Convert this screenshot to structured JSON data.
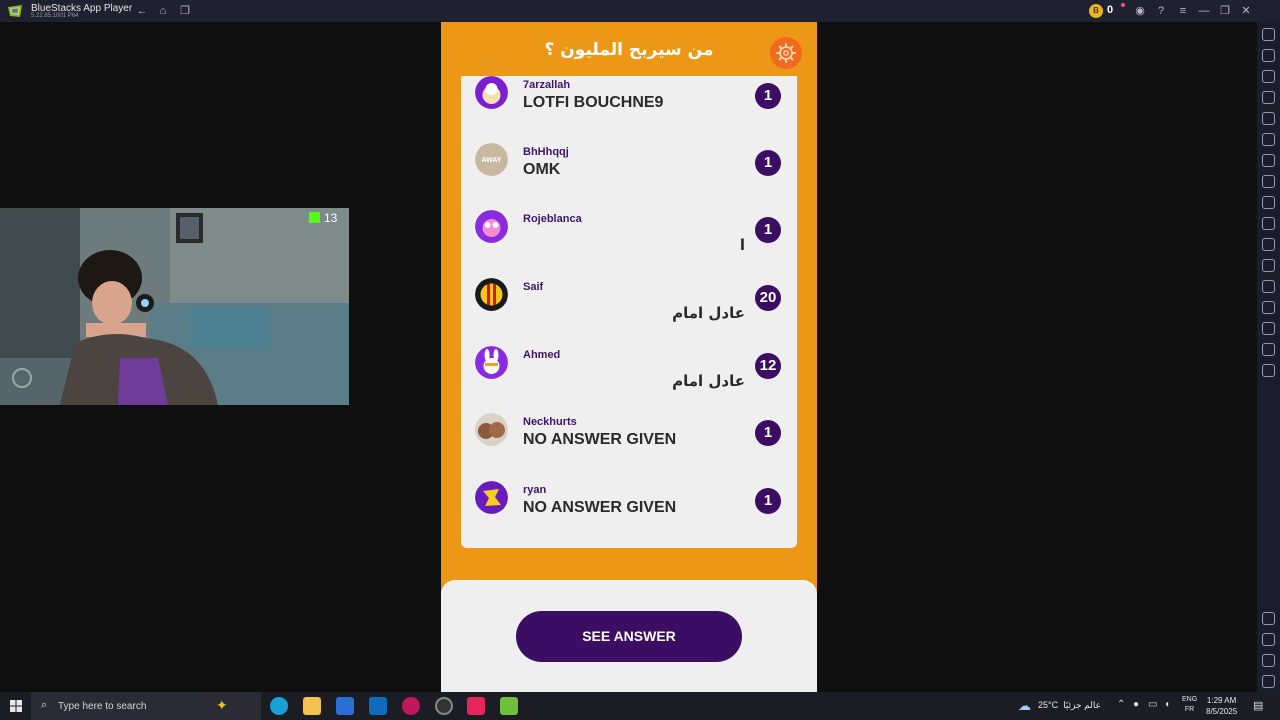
{
  "window": {
    "title": "BlueStacks App Player",
    "version": "5.22.85.1001 P64",
    "coins": "0"
  },
  "game": {
    "title": "من سيربح المليون ؟",
    "rows": [
      {
        "user": "7arzallah",
        "answer": "LOTFI BOUCHNE9",
        "count": "1",
        "rtl": false
      },
      {
        "user": "BhHhqqj",
        "answer": "OMK",
        "count": "1",
        "rtl": false
      },
      {
        "user": "Rojeblanca",
        "answer": "ا",
        "count": "1",
        "rtl": true
      },
      {
        "user": "Saif",
        "answer": "عادل امام",
        "count": "20",
        "rtl": true
      },
      {
        "user": "Ahmed",
        "answer": "عادل امام",
        "count": "12",
        "rtl": true
      },
      {
        "user": "Neckhurts",
        "answer": "NO ANSWER GIVEN",
        "count": "1",
        "rtl": false
      },
      {
        "user": "ryan",
        "answer": "NO ANSWER GIVEN",
        "count": "1",
        "rtl": false
      }
    ],
    "see_answer_label": "SEE ANSWER"
  },
  "webcam": {
    "viewers": "13"
  },
  "taskbar": {
    "search_placeholder": "Type here to search",
    "weather": "25°C",
    "weather_text": "عالم جزئيًا",
    "lang_top": "ENG",
    "lang_bottom": "FR",
    "time": "1:29 AM",
    "date": "8/5/2025"
  },
  "colors": {
    "orange": "#ec9816",
    "purple": "#3b0d63",
    "card": "#efefef"
  }
}
